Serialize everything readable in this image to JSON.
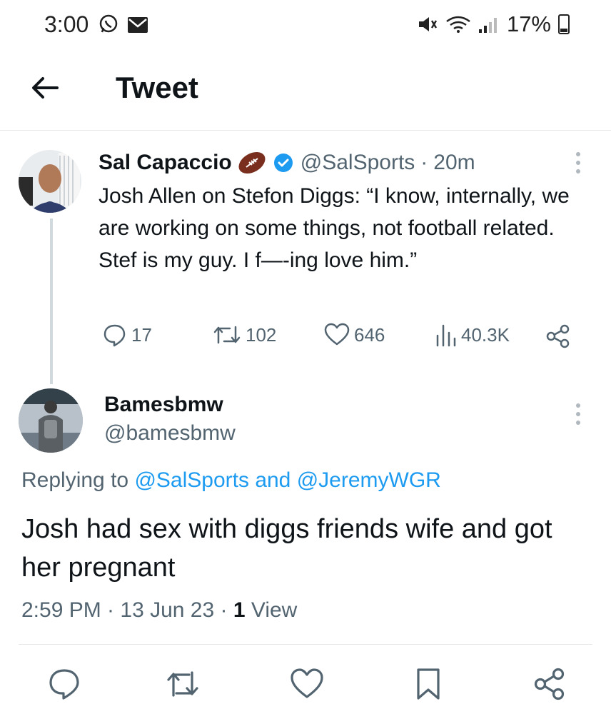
{
  "status_bar": {
    "time": "3:00",
    "battery": "17%"
  },
  "header": {
    "title": "Tweet"
  },
  "tweet": {
    "author_name": "Sal Capaccio",
    "author_handle": "@SalSports",
    "time_ago": "20m",
    "text": "Josh Allen on Stefon Diggs: “I know, internally, we are working on some things, not football related. Stef is my guy. I f—-ing love him.”",
    "replies": "17",
    "retweets": "102",
    "likes": "646",
    "views": "40.3K"
  },
  "reply": {
    "author_name": "Bamesbmw",
    "author_handle": "@bamesbmw",
    "replying_prefix": "Replying to",
    "replying_to_1": "@SalSports",
    "replying_and": "and",
    "replying_to_2": "@JeremyWGR",
    "text": "Josh had sex with  diggs friends wife and got her pregnant",
    "timestamp": "2:59 PM · 13 Jun 23 · ",
    "view_count": "1",
    "view_label": "View"
  },
  "colors": {
    "accent": "#1d9bf0",
    "text": "#0f1419",
    "muted": "#536471"
  }
}
